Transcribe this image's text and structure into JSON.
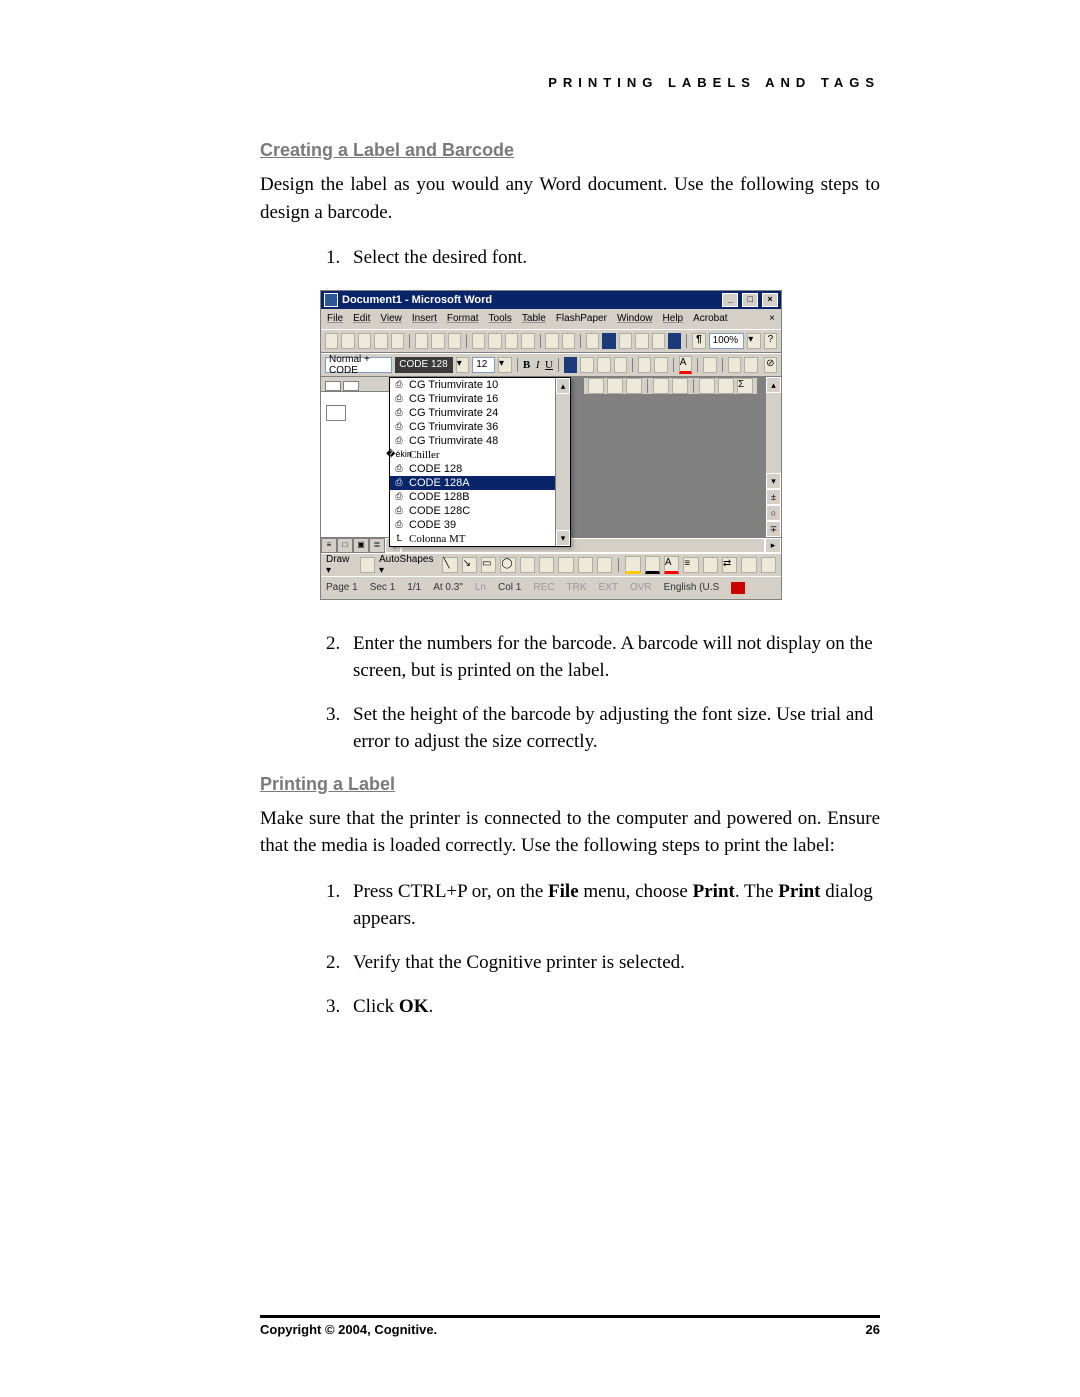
{
  "running_head": "PRINTING LABELS AND TAGS",
  "section1": {
    "title": "Creating a Label and Barcode",
    "intro": "Design the label as you would any Word document. Use the following steps to design a barcode.",
    "step1": "Select the desired font.",
    "step2": "Enter the numbers for the barcode. A barcode will not display on the screen, but is printed on the label.",
    "step3": "Set the height of the barcode by adjusting the font size. Use trial and error to adjust the size correctly."
  },
  "section2": {
    "title": "Printing a Label",
    "intro": "Make sure that the printer is connected to the computer and powered on. Ensure that the media is loaded correctly. Use the following steps to print the label:",
    "step1_pre": "Press CTRL+P or, on the ",
    "step1_b1": "File",
    "step1_mid": " menu, choose ",
    "step1_b2": "Print",
    "step1_post1": ". The ",
    "step1_b3": "Print",
    "step1_post2": " dialog appears.",
    "step2": "Verify that the Cognitive printer is selected.",
    "step3_pre": "Click ",
    "step3_b": "OK",
    "step3_post": "."
  },
  "word": {
    "title": "Document1 - Microsoft Word",
    "menus": [
      "File",
      "Edit",
      "View",
      "Insert",
      "Format",
      "Tools",
      "Table",
      "FlashPaper",
      "Window",
      "Help",
      "Acrobat"
    ],
    "close_x": "×",
    "style_box": "Normal + CODE",
    "font_box": "CODE 128",
    "size_box": "12",
    "zoom": "100%",
    "fonts": [
      {
        "name": "CG Triumvirate 10",
        "printer": true
      },
      {
        "name": "CG Triumvirate 16",
        "printer": true
      },
      {
        "name": "CG Triumvirate 24",
        "printer": true
      },
      {
        "name": "CG Triumvirate 36",
        "printer": true
      },
      {
        "name": "CG Triumvirate 48",
        "printer": true
      },
      {
        "name": "Chiller",
        "printer": false
      },
      {
        "name": "CODE 128",
        "printer": true
      },
      {
        "name": "CODE 128A",
        "printer": true,
        "selected": true
      },
      {
        "name": "CODE 128B",
        "printer": true
      },
      {
        "name": "CODE 128C",
        "printer": true
      },
      {
        "name": "CODE 39",
        "printer": true
      },
      {
        "name": "Colonna MT",
        "printer": false
      }
    ],
    "draw_label": "Draw ▾",
    "autoshapes_label": "AutoShapes ▾",
    "status": {
      "page": "Page  1",
      "sec": "Sec 1",
      "pages": "1/1",
      "at": "At  0.3\"",
      "ln": "Ln",
      "col": "Col  1",
      "rec": "REC",
      "trk": "TRK",
      "ext": "EXT",
      "ovr": "OVR",
      "lang": "English (U.S"
    }
  },
  "footer": {
    "left": "Copyright © 2004, Cognitive.",
    "right": "26"
  }
}
